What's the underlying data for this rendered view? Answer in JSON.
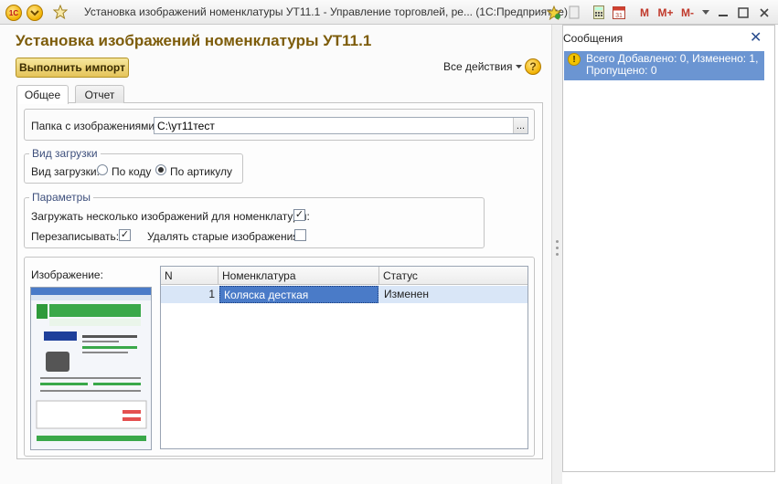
{
  "window": {
    "title": "Установка изображений номенклатуры УТ11.1 - Управление торговлей, ре...  (1С:Предприятие)",
    "logo_text": "1С",
    "m_label": "M",
    "m_plus_label": "M+",
    "m_minus_label": "M-"
  },
  "form": {
    "title": "Установка изображений номенклатуры УТ11.1",
    "import_button": "Выполнить импорт",
    "all_actions": "Все действия",
    "help": "?",
    "tabs": [
      {
        "label": "Общее",
        "active": true
      },
      {
        "label": "Отчет",
        "active": false
      }
    ],
    "folder_label": "Папка с изображениями:",
    "folder_value": "C:\\ут11тест",
    "folder_browse": "...",
    "load_type_group": "Вид загрузки",
    "load_type_label": "Вид загрузки:",
    "load_type_options": [
      {
        "label": "По коду",
        "checked": false
      },
      {
        "label": "По артикулу",
        "checked": true
      }
    ],
    "params_group": "Параметры",
    "multi_images_label": "Загружать несколько изображений для номенклатуры:",
    "multi_images_checked": true,
    "overwrite_label": "Перезаписывать:",
    "overwrite_checked": true,
    "delete_old_label": "Удалять старые изображения:",
    "delete_old_checked": false,
    "image_label": "Изображение:"
  },
  "table": {
    "columns": [
      "N",
      "Номенклатура",
      "Статус"
    ],
    "rows": [
      {
        "n": "1",
        "item": "Коляска десткая",
        "status": "Изменен"
      }
    ]
  },
  "messages": {
    "title": "Сообщения",
    "close": "✕",
    "items": [
      {
        "text": "Всего Добавлено: 0, Изменено: 1, Пропущено: 0"
      }
    ]
  },
  "colors": {
    "accent_gold": "#e5c45a",
    "title_brown": "#7d5c0a",
    "selection_blue": "#4a7bc8",
    "message_blue": "#6b95d2"
  }
}
